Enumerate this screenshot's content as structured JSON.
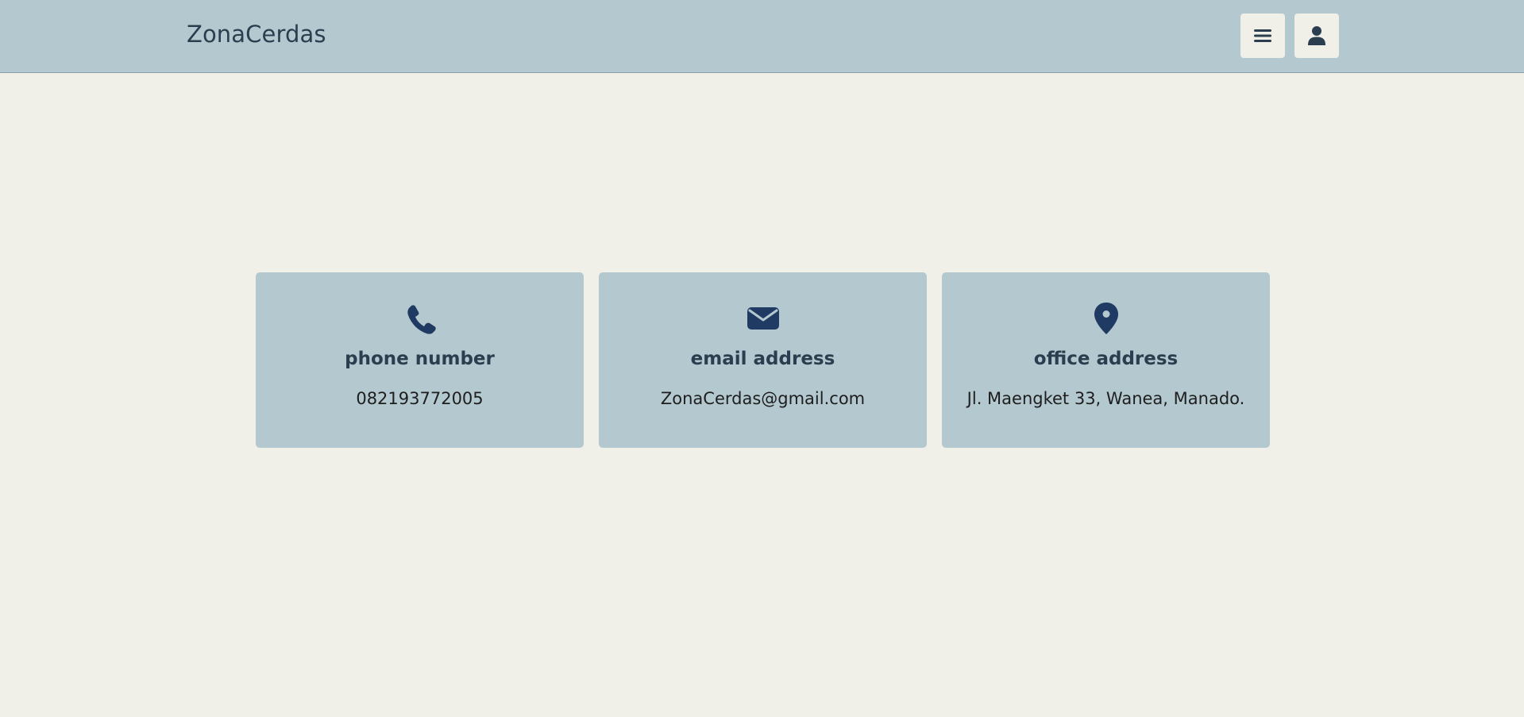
{
  "header": {
    "brand": "ZonaCerdas",
    "menu_icon": "hamburger-menu-icon",
    "user_icon": "user-icon"
  },
  "contact": {
    "cards": [
      {
        "icon": "phone-icon",
        "title": "phone number",
        "value": "082193772005"
      },
      {
        "icon": "envelope-icon",
        "title": "email address",
        "value": "ZonaCerdas@gmail.com"
      },
      {
        "icon": "map-pin-icon",
        "title": "office address",
        "value": "Jl. Maengket 33, Wanea, Manado."
      }
    ]
  },
  "colors": {
    "header_bg": "#b4c8cf",
    "page_bg": "#f0f0e9",
    "card_bg": "#b4c8cf",
    "icon_color": "#1f3b63",
    "text_dark": "#2b3e50"
  }
}
